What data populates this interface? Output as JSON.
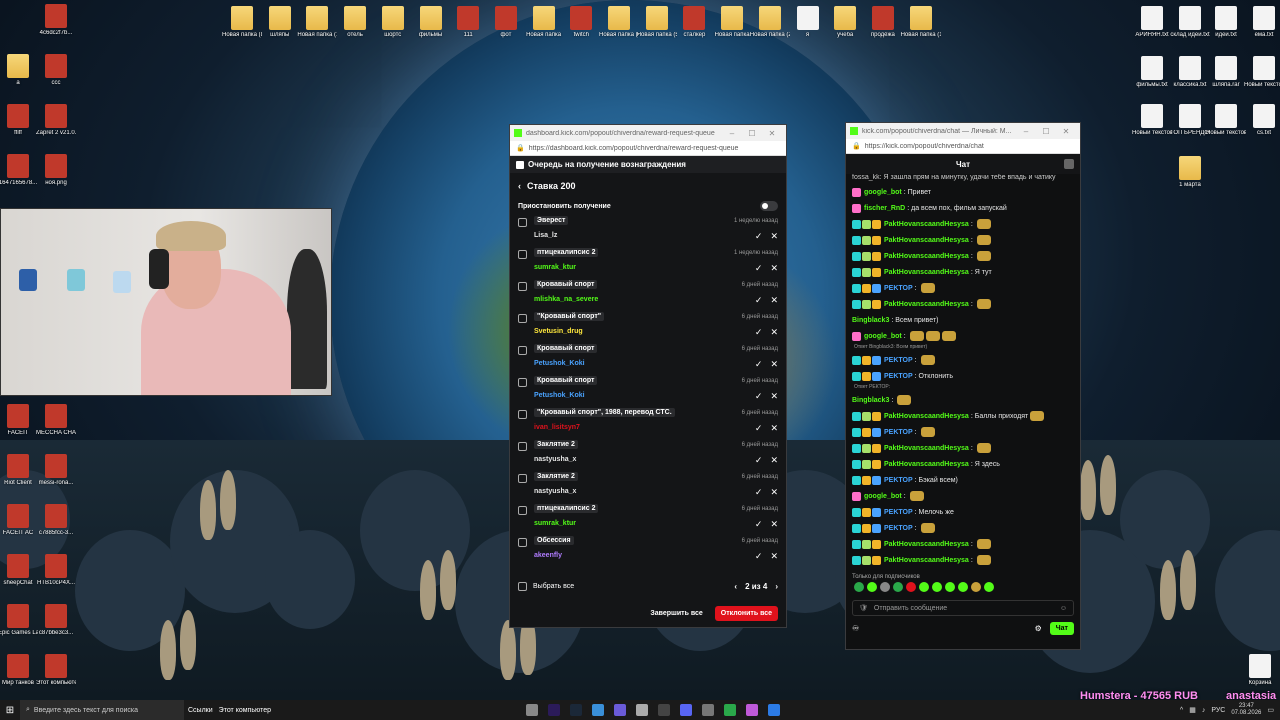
{
  "desktop_top_icons": [
    {
      "label": "Новая папка (8)",
      "type": "folder"
    },
    {
      "label": "шляпы",
      "type": "folder"
    },
    {
      "label": "Новая папка (12)",
      "type": "folder"
    },
    {
      "label": "отель",
      "type": "folder"
    },
    {
      "label": "шортс",
      "type": "folder"
    },
    {
      "label": "фильмы",
      "type": "folder"
    },
    {
      "label": "111",
      "type": "app"
    },
    {
      "label": "фот",
      "type": "app"
    },
    {
      "label": "Новая папка",
      "type": "folder"
    },
    {
      "label": "twitch",
      "type": "app"
    },
    {
      "label": "Новая папка (4)",
      "type": "folder"
    },
    {
      "label": "Новая папка (5)",
      "type": "folder"
    },
    {
      "label": "сталкер",
      "type": "app"
    },
    {
      "label": "Новая папка",
      "type": "folder"
    },
    {
      "label": "Новая папка (2)",
      "type": "folder"
    },
    {
      "label": "я",
      "type": "file"
    },
    {
      "label": "учеба",
      "type": "folder"
    },
    {
      "label": "продёжа",
      "type": "app"
    },
    {
      "label": "Новая папка (13)",
      "type": "folder"
    }
  ],
  "desktop_right_icons": [
    {
      "label": "АРИНЯН.txt"
    },
    {
      "label": "склад идей.txt"
    },
    {
      "label": "идеи.txt"
    },
    {
      "label": "ема.txt"
    },
    {
      "label": "фильмы.txt"
    },
    {
      "label": "классика.txt"
    },
    {
      "label": "шляпа.rar"
    },
    {
      "label": "Новый текстов..."
    },
    {
      "label": "Новый текстовый..."
    },
    {
      "label": "ТОП БРЕНДОВ.txt"
    },
    {
      "label": "Новый текстов..."
    },
    {
      "label": "cs.txt"
    },
    {
      "label": "1 марта"
    },
    {
      "label": "Корзина"
    }
  ],
  "desktop_left_icons": [
    {
      "label": "4c6dc2f7b..."
    },
    {
      "label": "a"
    },
    {
      "label": "ccc"
    },
    {
      "label": "ffiff"
    },
    {
      "label": "Zapret 2 v21.0.0.6"
    },
    {
      "label": "1647165678..."
    },
    {
      "label": "ноя.png"
    },
    {
      "label": "FACEIT"
    },
    {
      "label": "MECCHA CHAMELE..."
    },
    {
      "label": "Riot Client"
    },
    {
      "label": "messi-rona..."
    },
    {
      "label": "FACEIT AC"
    },
    {
      "label": "c7885fcc-3..."
    },
    {
      "label": "sheepChat"
    },
    {
      "label": "HTB10cP4X..."
    },
    {
      "label": "Epic Games Launcher"
    },
    {
      "label": "c87bbe3c3..."
    },
    {
      "label": "Мир танков"
    },
    {
      "label": "Этот компьютер"
    }
  ],
  "reward_window": {
    "title": "dashboard.kick.com/popout/chiverdna/reward-request-queue",
    "url": "https://dashboard.kick.com/popout/chiverdna/reward-request-queue",
    "header": "Очередь на получение вознаграждения",
    "back_title": "Ставка 200",
    "pause_label": "Приостановить получение",
    "items": [
      {
        "reward": "Эверест",
        "user": "Lisa_lz",
        "time": "1 неделю назад",
        "color": "#e6e6e6"
      },
      {
        "reward": "птицекалипсис 2",
        "user": "sumrak_ktur",
        "time": "1 неделю назад",
        "color": "#53fc18"
      },
      {
        "reward": "Кровавый спорт",
        "user": "mlishka_na_severe",
        "time": "6 дней назад",
        "color": "#53fc18"
      },
      {
        "reward": "\"Кровавый спорт\"",
        "user": "Svetusin_drug",
        "time": "6 дней назад",
        "color": "#ffe83d"
      },
      {
        "reward": "Кровавый спорт",
        "user": "Petushok_Koki",
        "time": "6 дней назад",
        "color": "#4aa3ff"
      },
      {
        "reward": "Кровавый спорт",
        "user": "Petushok_Koki",
        "time": "6 дней назад",
        "color": "#4aa3ff"
      },
      {
        "reward": "\"Кровавый спорт\", 1988, перевод СТС.",
        "user": "ivan_lisitsyn7",
        "time": "6 дней назад",
        "color": "#e0121c"
      },
      {
        "reward": "Заклятие 2",
        "user": "nastyusha_x",
        "time": "6 дней назад",
        "color": "#e6e6e6"
      },
      {
        "reward": "Заклятие 2",
        "user": "nastyusha_x",
        "time": "6 дней назад",
        "color": "#e6e6e6"
      },
      {
        "reward": "птицекалипсис 2",
        "user": "sumrak_ktur",
        "time": "6 дней назад",
        "color": "#53fc18"
      },
      {
        "reward": "Обсессия",
        "user": "akeenfly",
        "time": "6 дней назад",
        "color": "#b07cff"
      }
    ],
    "select_all": "Выбрать все",
    "pagination": "2 из 4",
    "complete_all": "Завершить все",
    "reject_all": "Отклонить все"
  },
  "chat_window": {
    "title": "kick.com/popout/chiverdna/chat — Личный: M...",
    "url": "https://kick.com/popout/chiverdna/chat",
    "header": "Чат",
    "pinned": "fossa_kk: Я зашла прям на минутку, удачи тебе впадь и чатику",
    "messages": [
      {
        "name": "google_bot",
        "text": "Привет",
        "color": "#53fc18",
        "badges": [
          "#ff6fc9"
        ],
        "reply": "",
        "emotes": 0
      },
      {
        "name": "fischer_RnD",
        "text": "да всем пох, фильм запускай",
        "color": "#53fc18",
        "badges": [
          "#ff6fc9"
        ],
        "reply": "",
        "emotes": 0
      },
      {
        "name": "PaktHovanscaandHesysa",
        "text": "",
        "color": "#53fc18",
        "badges": [
          "#2ad4d4",
          "#a6e06a",
          "#f0b429"
        ],
        "reply": "",
        "emotes": 1
      },
      {
        "name": "PaktHovanscaandHesysa",
        "text": "",
        "color": "#53fc18",
        "badges": [
          "#2ad4d4",
          "#a6e06a",
          "#f0b429"
        ],
        "reply": "",
        "emotes": 1
      },
      {
        "name": "PaktHovanscaandHesysa",
        "text": "",
        "color": "#53fc18",
        "badges": [
          "#2ad4d4",
          "#a6e06a",
          "#f0b429"
        ],
        "reply": "",
        "emotes": 1
      },
      {
        "name": "PaktHovanscaandHesysa",
        "text": "Я тут",
        "color": "#53fc18",
        "badges": [
          "#2ad4d4",
          "#a6e06a",
          "#f0b429"
        ],
        "reply": "",
        "emotes": 0
      },
      {
        "name": "PEKTOP",
        "text": "",
        "color": "#4aa3ff",
        "badges": [
          "#2ad4d4",
          "#f0b429",
          "#4aa3ff"
        ],
        "reply": "",
        "emotes": 1
      },
      {
        "name": "PaktHovanscaandHesysa",
        "text": "",
        "color": "#53fc18",
        "badges": [
          "#2ad4d4",
          "#a6e06a",
          "#f0b429"
        ],
        "reply": "",
        "emotes": 1
      },
      {
        "name": "Bingblack3",
        "text": "Всем привет)",
        "color": "#53fc18",
        "badges": [],
        "reply": "",
        "emotes": 0
      },
      {
        "name": "google_bot",
        "text": "",
        "color": "#53fc18",
        "badges": [
          "#ff6fc9"
        ],
        "reply": "",
        "emotes": 3
      },
      {
        "name": "PEKTOP",
        "text": "",
        "color": "#4aa3ff",
        "badges": [
          "#2ad4d4",
          "#f0b429",
          "#4aa3ff"
        ],
        "reply": "Ответ Bingblack3: Всем привет)",
        "emotes": 1
      },
      {
        "name": "PEKTOP",
        "text": "Отклонить",
        "color": "#4aa3ff",
        "badges": [
          "#2ad4d4",
          "#f0b429",
          "#4aa3ff"
        ],
        "reply": "",
        "emotes": 0
      },
      {
        "name": "Bingblack3",
        "text": "",
        "color": "#53fc18",
        "badges": [],
        "reply": "Ответ РЕКТОР:",
        "emotes": 1
      },
      {
        "name": "PaktHovanscaandHesysa",
        "text": "Баллы приходят",
        "color": "#53fc18",
        "badges": [
          "#2ad4d4",
          "#a6e06a",
          "#f0b429"
        ],
        "reply": "",
        "emotes": 1
      },
      {
        "name": "PEKTOP",
        "text": "",
        "color": "#4aa3ff",
        "badges": [
          "#2ad4d4",
          "#f0b429",
          "#4aa3ff"
        ],
        "reply": "",
        "emotes": 1
      },
      {
        "name": "PaktHovanscaandHesysa",
        "text": "",
        "color": "#53fc18",
        "badges": [
          "#2ad4d4",
          "#a6e06a",
          "#f0b429"
        ],
        "reply": "",
        "emotes": 1
      },
      {
        "name": "PaktHovanscaandHesysa",
        "text": "Я здесь",
        "color": "#53fc18",
        "badges": [
          "#2ad4d4",
          "#a6e06a",
          "#f0b429"
        ],
        "reply": "",
        "emotes": 0
      },
      {
        "name": "PEKTOP",
        "text": "Бэкай всем)",
        "color": "#4aa3ff",
        "badges": [
          "#2ad4d4",
          "#f0b429",
          "#4aa3ff"
        ],
        "reply": "",
        "emotes": 0
      },
      {
        "name": "google_bot",
        "text": "",
        "color": "#53fc18",
        "badges": [
          "#ff6fc9"
        ],
        "reply": "",
        "emotes": 1
      },
      {
        "name": "PEKTOP",
        "text": "Мелочь же",
        "color": "#4aa3ff",
        "badges": [
          "#2ad4d4",
          "#f0b429",
          "#4aa3ff"
        ],
        "reply": "",
        "emotes": 0
      },
      {
        "name": "PEKTOP",
        "text": "",
        "color": "#4aa3ff",
        "badges": [
          "#2ad4d4",
          "#f0b429",
          "#4aa3ff"
        ],
        "reply": "",
        "emotes": 1
      },
      {
        "name": "PaktHovanscaandHesysa",
        "text": "",
        "color": "#53fc18",
        "badges": [
          "#2ad4d4",
          "#a6e06a",
          "#f0b429"
        ],
        "reply": "",
        "emotes": 1
      },
      {
        "name": "PaktHovanscaandHesysa",
        "text": "",
        "color": "#53fc18",
        "badges": [
          "#2ad4d4",
          "#a6e06a",
          "#f0b429"
        ],
        "reply": "",
        "emotes": 1
      }
    ],
    "sub_only": "Только для подписчиков",
    "input_placeholder": "Отправить сообщение",
    "send_label": "Чат"
  },
  "taskbar": {
    "search_placeholder": "Введите здесь текст для поиска",
    "links_label": "Ссылки",
    "computer_label": "Этот компьютер",
    "lang": "РУС",
    "time": "23:47",
    "date": "07.08.2026"
  },
  "overlay": {
    "donation": "Humstera - 47565 RUB",
    "name": "anastasia"
  }
}
